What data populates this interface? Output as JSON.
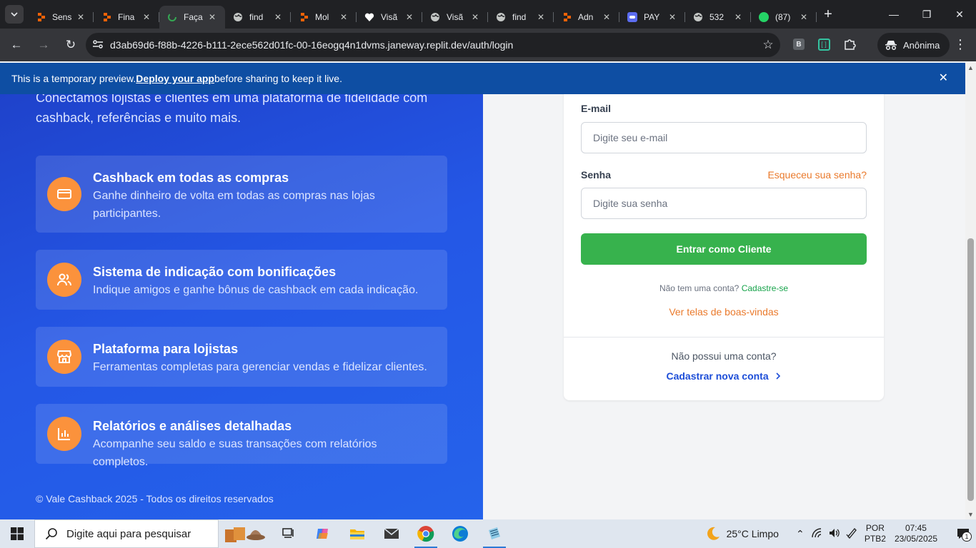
{
  "browser": {
    "tabs": [
      {
        "title": "Sens",
        "favicon": "replit-icon",
        "favicon_color": "#f26207",
        "active": false
      },
      {
        "title": "Fina",
        "favicon": "replit-icon",
        "favicon_color": "#f26207",
        "active": false
      },
      {
        "title": "Faça",
        "favicon": "loading-icon",
        "favicon_color": "#34a853",
        "active": true
      },
      {
        "title": "find",
        "favicon": "globe-icon",
        "favicon_color": "#c4c7c5",
        "active": false
      },
      {
        "title": "Mol",
        "favicon": "replit-icon",
        "favicon_color": "#f26207",
        "active": false
      },
      {
        "title": "Visã",
        "favicon": "heart-icon",
        "favicon_color": "#ffffff",
        "active": false
      },
      {
        "title": "Visã",
        "favicon": "globe-icon",
        "favicon_color": "#c4c7c5",
        "active": false
      },
      {
        "title": "find",
        "favicon": "globe-icon",
        "favicon_color": "#c4c7c5",
        "active": false
      },
      {
        "title": "Adn",
        "favicon": "replit-icon",
        "favicon_color": "#f26207",
        "active": false
      },
      {
        "title": "PAY",
        "favicon": "app-icon",
        "favicon_color": "#5b6cf0",
        "active": false
      },
      {
        "title": "532",
        "favicon": "globe-icon",
        "favicon_color": "#c4c7c5",
        "active": false
      },
      {
        "title": "(87)",
        "favicon": "whatsapp-icon",
        "favicon_color": "#25d366",
        "active": false
      }
    ],
    "url": "d3ab69d6-f88b-4226-b111-2ece562d01fc-00-16eogq4n1dvms.janeway.replit.dev/auth/login",
    "incognito_label": "Anônima",
    "ext_b_label": "B"
  },
  "banner": {
    "text_before": "This is a temporary preview. ",
    "link": "Deploy your app",
    "text_after": " before sharing to keep it live."
  },
  "hero": {
    "tagline": "Conectamos lojistas e clientes em uma plataforma de fidelidade com cashback, referências e muito mais.",
    "features": [
      {
        "icon": "credit-card-icon",
        "title": "Cashback em todas as compras",
        "desc": "Ganhe dinheiro de volta em todas as compras nas lojas participantes."
      },
      {
        "icon": "users-icon",
        "title": "Sistema de indicação com bonificações",
        "desc": "Indique amigos e ganhe bônus de cashback em cada indicação."
      },
      {
        "icon": "store-icon",
        "title": "Plataforma para lojistas",
        "desc": "Ferramentas completas para gerenciar vendas e fidelizar clientes."
      },
      {
        "icon": "bar-chart-icon",
        "title": "Relatórios e análises detalhadas",
        "desc": "Acompanhe seu saldo e suas transações com relatórios completos."
      }
    ],
    "copyright": "© Vale Cashback 2025 - Todos os direitos reservados"
  },
  "login": {
    "email_label": "E-mail",
    "email_placeholder": "Digite seu e-mail",
    "email_value": "",
    "password_label": "Senha",
    "forgot": "Esqueceu sua senha?",
    "password_placeholder": "Digite sua senha",
    "password_value": "",
    "submit": "Entrar como Cliente",
    "no_account_q": "Não tem uma conta?",
    "signup_link": "Cadastre-se",
    "welcome_link": "Ver telas de boas-vindas",
    "footer_q": "Não possui uma conta?",
    "footer_link": "Cadastrar nova conta"
  },
  "taskbar": {
    "search_placeholder": "Digite aqui para pesquisar",
    "weather": "25°C  Limpo",
    "lang_1": "POR",
    "lang_2": "PTB2",
    "time": "07:45",
    "date": "23/05/2025",
    "notifications": "1"
  },
  "colors": {
    "accent_orange": "#fb923c",
    "primary_green": "#37b24d",
    "hero_blue": "#2457e6",
    "link_blue": "#1d4ed8"
  }
}
